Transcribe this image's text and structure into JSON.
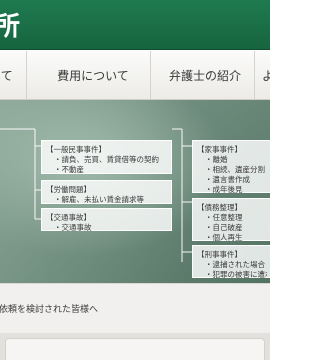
{
  "header": {
    "brand_char": "所"
  },
  "nav": {
    "items": [
      {
        "label": "いて"
      },
      {
        "label": "費用について"
      },
      {
        "label": "弁護士の紹介"
      },
      {
        "label": "よ"
      }
    ]
  },
  "hero": {
    "general": {
      "title": "【一般民事事件】",
      "items": [
        "・請負、売買、賃貸借等の契約",
        "・不動産"
      ]
    },
    "labor": {
      "title": "【労働問題】",
      "items": [
        "・解雇、未払い賃金請求等"
      ]
    },
    "traffic": {
      "title": "【交通事故】",
      "items": [
        "・交通事故"
      ]
    },
    "family": {
      "title": "【家事事件】",
      "items": [
        "・離婚",
        "・相続、遺産分割",
        "・遺言書作成",
        "・成年後見"
      ]
    },
    "debt": {
      "title": "【債務整理】",
      "items": [
        "・任意整理",
        "・自己破産",
        "・個人再生"
      ]
    },
    "criminal": {
      "title": "【刑事事件】",
      "items": [
        "・逮捕された場合",
        "・犯罪の被害に遭われた"
      ]
    }
  },
  "strip": {
    "text": "依頼を検討された皆様へ"
  }
}
